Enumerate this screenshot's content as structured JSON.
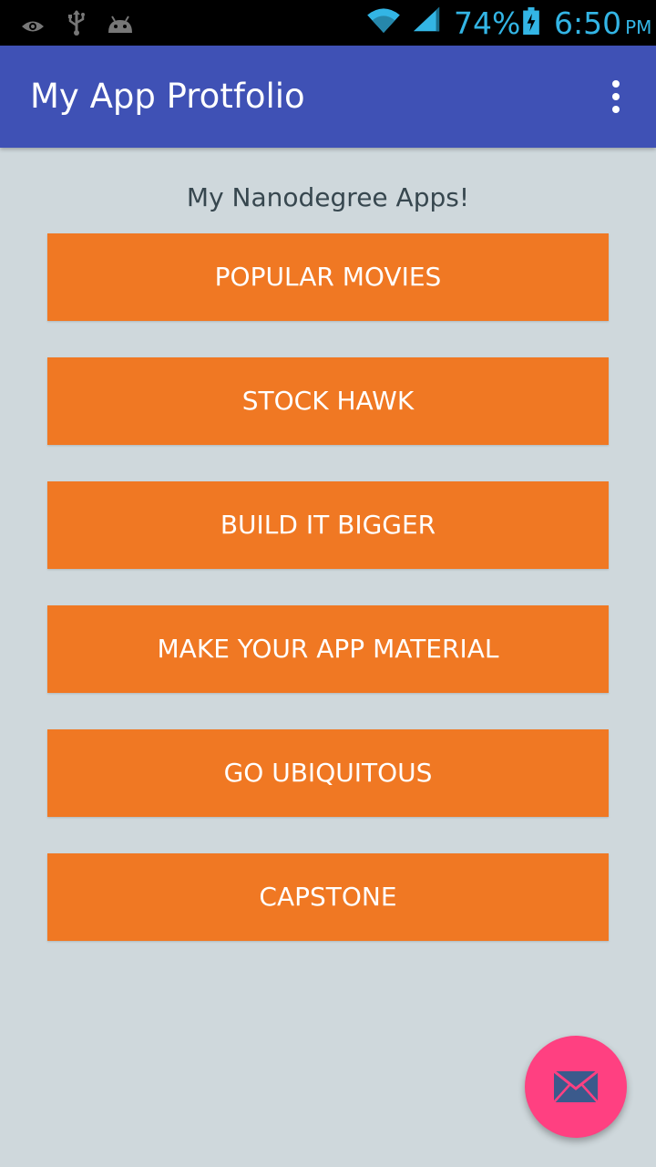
{
  "status_bar": {
    "icons": [
      "eye-icon",
      "usb-icon",
      "android-icon",
      "wifi-icon",
      "signal-icon",
      "battery-charging-icon"
    ],
    "battery_percent": "74%",
    "time": "6:50",
    "ampm": "PM",
    "accent_color": "#33b5e5"
  },
  "app_bar": {
    "title": "My App Protfolio",
    "menu_icon": "overflow-menu-icon",
    "color": "#3f51b5"
  },
  "main": {
    "heading": "My Nanodegree Apps!",
    "buttons": [
      {
        "label": "POPULAR MOVIES"
      },
      {
        "label": "STOCK HAWK"
      },
      {
        "label": "BUILD IT BIGGER"
      },
      {
        "label": "MAKE YOUR APP MATERIAL"
      },
      {
        "label": "GO UBIQUITOUS"
      },
      {
        "label": "CAPSTONE"
      }
    ],
    "button_color": "#f07823",
    "background_color": "#cfd8dc"
  },
  "fab": {
    "icon": "mail-icon",
    "color": "#ff4081"
  }
}
